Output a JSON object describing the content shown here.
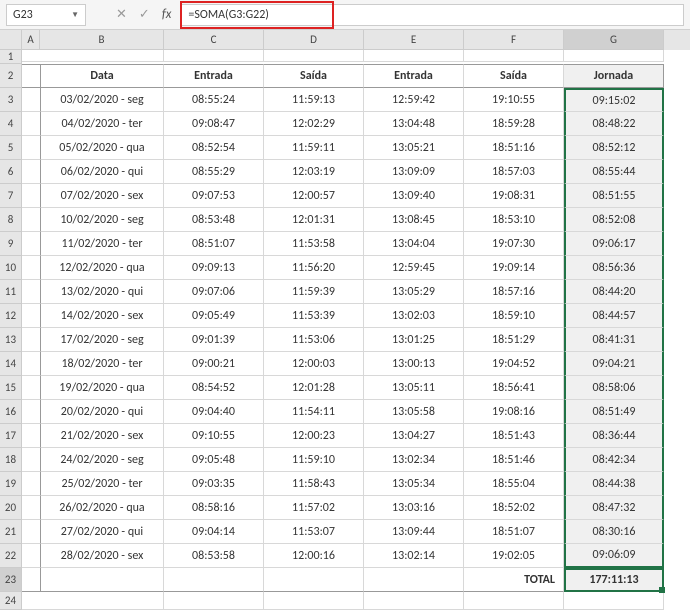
{
  "nameBox": "G23",
  "formula": "=SOMA(G3:G22)",
  "columns": [
    "A",
    "B",
    "C",
    "D",
    "E",
    "F",
    "G"
  ],
  "headers": {
    "data": "Data",
    "entrada1": "Entrada",
    "saida1": "Saída",
    "entrada2": "Entrada",
    "saida2": "Saída",
    "jornada": "Jornada"
  },
  "rows": [
    {
      "n": 3,
      "data": "03/02/2020 - seg",
      "e1": "08:55:24",
      "s1": "11:59:13",
      "e2": "12:59:42",
      "s2": "19:10:55",
      "j": "09:15:02"
    },
    {
      "n": 4,
      "data": "04/02/2020 - ter",
      "e1": "09:08:47",
      "s1": "12:02:29",
      "e2": "13:04:48",
      "s2": "18:59:28",
      "j": "08:48:22"
    },
    {
      "n": 5,
      "data": "05/02/2020 - qua",
      "e1": "08:52:54",
      "s1": "11:59:11",
      "e2": "13:05:21",
      "s2": "18:51:16",
      "j": "08:52:12"
    },
    {
      "n": 6,
      "data": "06/02/2020 - qui",
      "e1": "08:55:29",
      "s1": "12:03:19",
      "e2": "13:09:09",
      "s2": "18:57:03",
      "j": "08:55:44"
    },
    {
      "n": 7,
      "data": "07/02/2020 - sex",
      "e1": "09:07:53",
      "s1": "12:00:57",
      "e2": "13:09:40",
      "s2": "19:08:31",
      "j": "08:51:55"
    },
    {
      "n": 8,
      "data": "10/02/2020 - seg",
      "e1": "08:53:48",
      "s1": "12:01:31",
      "e2": "13:08:45",
      "s2": "18:53:10",
      "j": "08:52:08"
    },
    {
      "n": 9,
      "data": "11/02/2020 - ter",
      "e1": "08:51:07",
      "s1": "11:53:58",
      "e2": "13:04:04",
      "s2": "19:07:30",
      "j": "09:06:17"
    },
    {
      "n": 10,
      "data": "12/02/2020 - qua",
      "e1": "09:09:13",
      "s1": "11:56:20",
      "e2": "12:59:45",
      "s2": "19:09:14",
      "j": "08:56:36"
    },
    {
      "n": 11,
      "data": "13/02/2020 - qui",
      "e1": "09:07:06",
      "s1": "11:59:39",
      "e2": "13:05:29",
      "s2": "18:57:16",
      "j": "08:44:20"
    },
    {
      "n": 12,
      "data": "14/02/2020 - sex",
      "e1": "09:05:49",
      "s1": "11:53:39",
      "e2": "13:02:03",
      "s2": "18:59:10",
      "j": "08:44:57"
    },
    {
      "n": 13,
      "data": "17/02/2020 - seg",
      "e1": "09:01:39",
      "s1": "11:53:06",
      "e2": "13:01:25",
      "s2": "18:51:29",
      "j": "08:41:31"
    },
    {
      "n": 14,
      "data": "18/02/2020 - ter",
      "e1": "09:00:21",
      "s1": "12:00:03",
      "e2": "13:00:13",
      "s2": "19:04:52",
      "j": "09:04:21"
    },
    {
      "n": 15,
      "data": "19/02/2020 - qua",
      "e1": "08:54:52",
      "s1": "12:01:28",
      "e2": "13:05:11",
      "s2": "18:56:41",
      "j": "08:58:06"
    },
    {
      "n": 16,
      "data": "20/02/2020 - qui",
      "e1": "09:04:40",
      "s1": "11:54:11",
      "e2": "13:05:58",
      "s2": "19:08:16",
      "j": "08:51:49"
    },
    {
      "n": 17,
      "data": "21/02/2020 - sex",
      "e1": "09:10:55",
      "s1": "12:00:23",
      "e2": "13:04:27",
      "s2": "18:51:43",
      "j": "08:36:44"
    },
    {
      "n": 18,
      "data": "24/02/2020 - seg",
      "e1": "09:05:48",
      "s1": "11:59:10",
      "e2": "13:02:34",
      "s2": "18:51:46",
      "j": "08:42:34"
    },
    {
      "n": 19,
      "data": "25/02/2020 - ter",
      "e1": "09:03:35",
      "s1": "11:58:43",
      "e2": "13:05:34",
      "s2": "18:55:04",
      "j": "08:44:38"
    },
    {
      "n": 20,
      "data": "26/02/2020 - qua",
      "e1": "08:58:16",
      "s1": "11:57:02",
      "e2": "13:03:16",
      "s2": "18:52:02",
      "j": "08:47:32"
    },
    {
      "n": 21,
      "data": "27/02/2020 - qui",
      "e1": "09:04:14",
      "s1": "11:53:07",
      "e2": "13:09:44",
      "s2": "18:51:07",
      "j": "08:30:16"
    },
    {
      "n": 22,
      "data": "28/02/2020 - sex",
      "e1": "08:53:58",
      "s1": "12:00:16",
      "e2": "13:02:14",
      "s2": "19:02:05",
      "j": "09:06:09"
    }
  ],
  "total": {
    "label": "TOTAL",
    "value": "177:11:13"
  },
  "chart_data": null
}
